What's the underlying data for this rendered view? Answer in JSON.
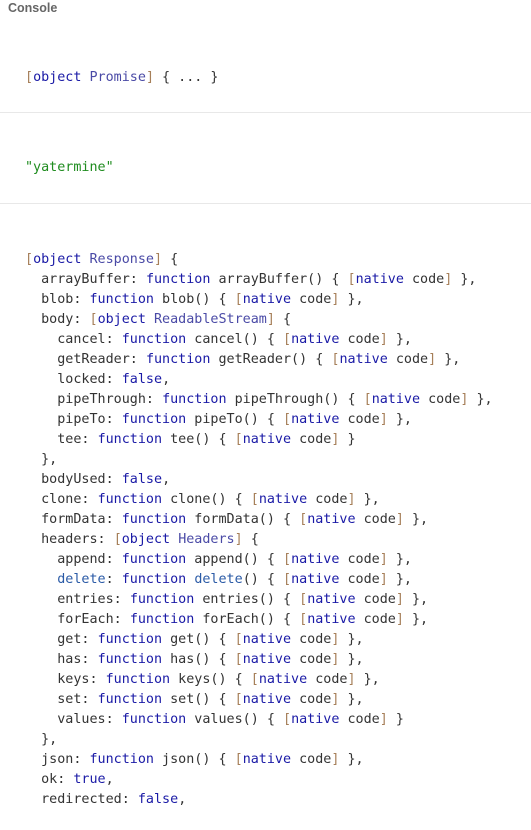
{
  "panel": {
    "title": "Console"
  },
  "entries": {
    "promise": "[object Promise] { ... }",
    "string": "\"yatermine\"",
    "response_lines": [
      "[object Response] {",
      "  arrayBuffer: function arrayBuffer() { [native code] },",
      "  blob: function blob() { [native code] },",
      "  body: [object ReadableStream] {",
      "    cancel: function cancel() { [native code] },",
      "    getReader: function getReader() { [native code] },",
      "    locked: false,",
      "    pipeThrough: function pipeThrough() { [native code] },",
      "    pipeTo: function pipeTo() { [native code] },",
      "    tee: function tee() { [native code] }",
      "  },",
      "  bodyUsed: false,",
      "  clone: function clone() { [native code] },",
      "  formData: function formData() { [native code] },",
      "  headers: [object Headers] {",
      "    append: function append() { [native code] },",
      "    delete: function delete() { [native code] },",
      "    entries: function entries() { [native code] },",
      "    forEach: function forEach() { [native code] },",
      "    get: function get() { [native code] },",
      "    has: function has() { [native code] },",
      "    keys: function keys() { [native code] },",
      "    set: function set() { [native code] },",
      "    values: function values() { [native code] }",
      "  },",
      "  json: function json() { [native code] },",
      "  ok: true,",
      "  redirected: false,"
    ]
  },
  "colors": {
    "keyword": "#1a1aa6",
    "bracket": "#a67f59",
    "string": "#1f8c1f",
    "text": "#333333",
    "header": "#666666",
    "divider": "#e8e8e8"
  }
}
